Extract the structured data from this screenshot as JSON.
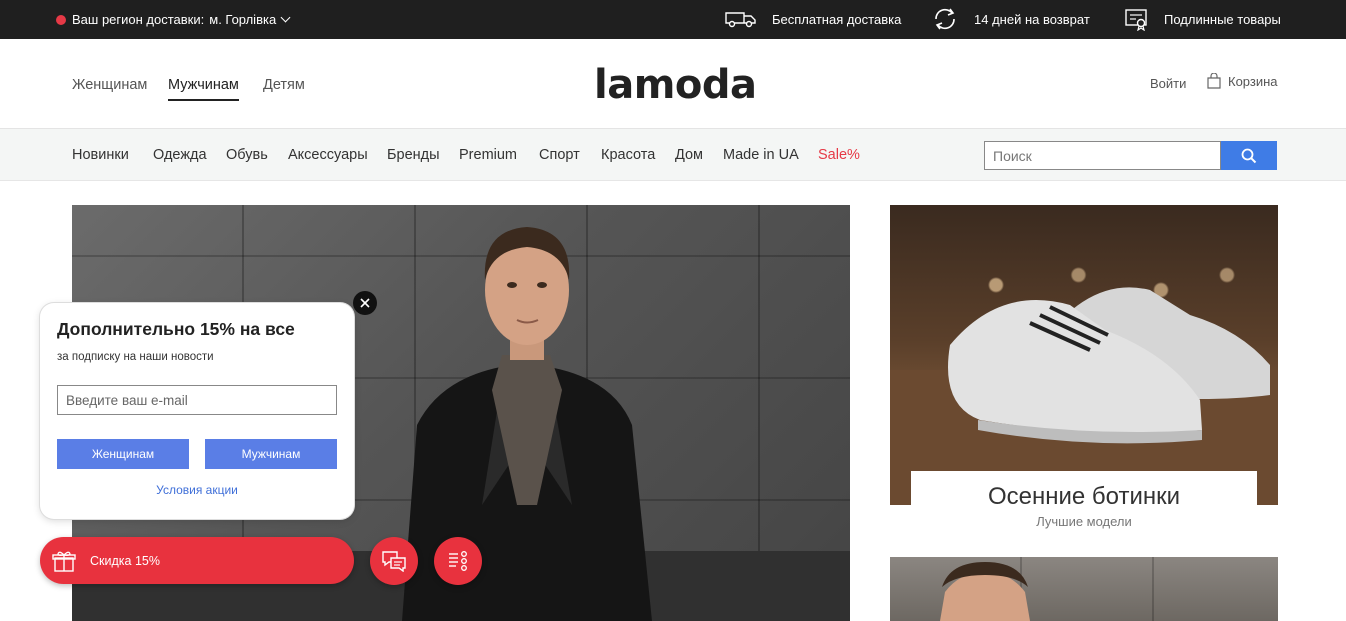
{
  "topbar": {
    "region_label": "Ваш регион доставки:",
    "region_city": "м. Горлівка",
    "perks": [
      {
        "icon": "delivery-truck-icon",
        "label": "Бесплатная доставка"
      },
      {
        "icon": "return-arrows-icon",
        "label": "14 дней на возврат"
      },
      {
        "icon": "certificate-icon",
        "label": "Подлинные товары"
      }
    ]
  },
  "header": {
    "logo": "lamoda",
    "genders": [
      "Женщинам",
      "Мужчинам",
      "Детям"
    ],
    "active_gender": "Мужчинам",
    "login": "Войти",
    "cart": "Корзина"
  },
  "nav": {
    "items": [
      "Новинки",
      "Одежда",
      "Обувь",
      "Аксессуары",
      "Бренды",
      "Premium",
      "Спорт",
      "Красота",
      "Дом",
      "Made in UA",
      "Sale%"
    ],
    "search_placeholder": "Поиск"
  },
  "cards": {
    "boots_title": "Осенние ботинки",
    "boots_subtitle": "Лучшие модели"
  },
  "popup": {
    "title": "Дополнительно 15% на все",
    "subtitle": "за подписку на наши новости",
    "email_placeholder": "Введите ваш e-mail",
    "btn_women": "Женщинам",
    "btn_men": "Мужчинам",
    "terms": "Условия акции"
  },
  "discount_label": "Скидка 15%",
  "colors": {
    "accent_red": "#e8323e",
    "accent_blue": "#3f7ce6",
    "topbar_bg": "#1f1f1f"
  }
}
